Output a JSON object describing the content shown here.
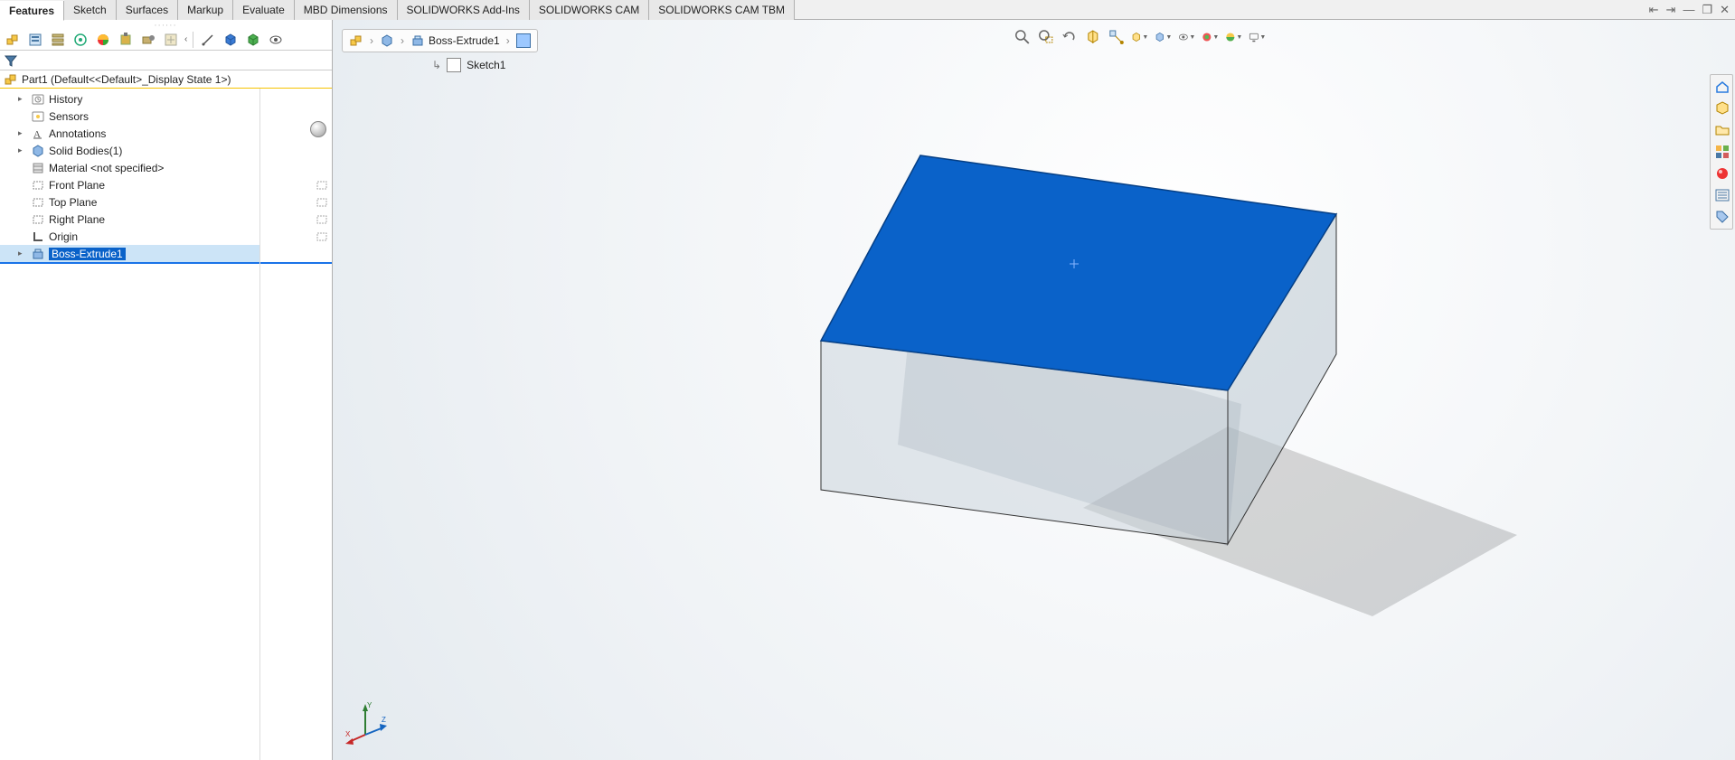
{
  "tabs": {
    "items": [
      "Features",
      "Sketch",
      "Surfaces",
      "Markup",
      "Evaluate",
      "MBD Dimensions",
      "SOLIDWORKS Add-Ins",
      "SOLIDWORKS CAM",
      "SOLIDWORKS CAM TBM"
    ],
    "active": 0
  },
  "part": {
    "name": "Part1  (Default<<Default>_Display State 1>)"
  },
  "tree": {
    "items": [
      {
        "label": "History",
        "icon": "history",
        "indent": 1,
        "expander": "▸"
      },
      {
        "label": "Sensors",
        "icon": "sensors",
        "indent": 1,
        "expander": ""
      },
      {
        "label": "Annotations",
        "icon": "annotations",
        "indent": 1,
        "expander": "▸"
      },
      {
        "label": "Solid Bodies(1)",
        "icon": "solid",
        "indent": 1,
        "expander": "▸"
      },
      {
        "label": "Material <not specified>",
        "icon": "material",
        "indent": 1,
        "expander": ""
      },
      {
        "label": "Front Plane",
        "icon": "plane",
        "indent": 1,
        "expander": "",
        "badge": true
      },
      {
        "label": "Top Plane",
        "icon": "plane",
        "indent": 1,
        "expander": "",
        "badge": true
      },
      {
        "label": "Right Plane",
        "icon": "plane",
        "indent": 1,
        "expander": "",
        "badge": true
      },
      {
        "label": "Origin",
        "icon": "origin",
        "indent": 1,
        "expander": "",
        "badge": true
      },
      {
        "label": "Boss-Extrude1",
        "icon": "extrude",
        "indent": 1,
        "expander": "▸",
        "selected": true
      }
    ]
  },
  "breadcrumb": {
    "featureLabel": "Boss-Extrude1",
    "sketchLabel": "Sketch1"
  },
  "windowControls": {
    "collapseLeft": "⇤",
    "collapseRight": "⇥",
    "minimize": "—",
    "maximize": "❐",
    "close": "✕"
  }
}
